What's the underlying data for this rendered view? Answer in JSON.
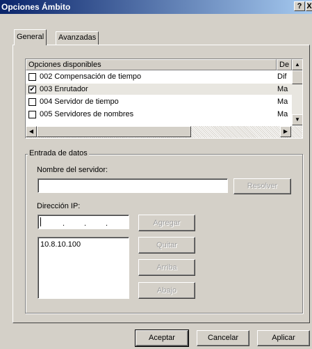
{
  "window": {
    "title": "Opciones Ámbito",
    "help_label": "?",
    "close_label": "X"
  },
  "tabs": [
    {
      "label": "General"
    },
    {
      "label": "Avanzadas"
    }
  ],
  "options_list": {
    "header_name": "Opciones disponibles",
    "header_desc": "De",
    "rows": [
      {
        "label": "002 Compensación de tiempo",
        "desc": "Dif",
        "checked": false
      },
      {
        "label": "003 Enrutador",
        "desc": "Ma",
        "checked": true
      },
      {
        "label": "004 Servidor de tiempo",
        "desc": "Ma",
        "checked": false
      },
      {
        "label": "005 Servidores de nombres",
        "desc": "Ma",
        "checked": false
      }
    ],
    "check_mark": "✔"
  },
  "data_entry": {
    "group_label": "Entrada de datos",
    "server_name_label": "Nombre del servidor:",
    "server_name_value": "",
    "resolve_label": "Resolver",
    "ip_label": "Dirección IP:",
    "ip_dots": ".",
    "add_label": "Agregar",
    "ip_list": [
      "10.8.10.100"
    ],
    "remove_label": "Quitar",
    "up_label": "Arriba",
    "down_label": "Abajo"
  },
  "footer": {
    "ok_label": "Aceptar",
    "cancel_label": "Cancelar",
    "apply_label": "Aplicar"
  },
  "colors": {
    "face": "#d4d0c8",
    "title_start": "#0a246a",
    "title_end": "#a6caf0"
  }
}
